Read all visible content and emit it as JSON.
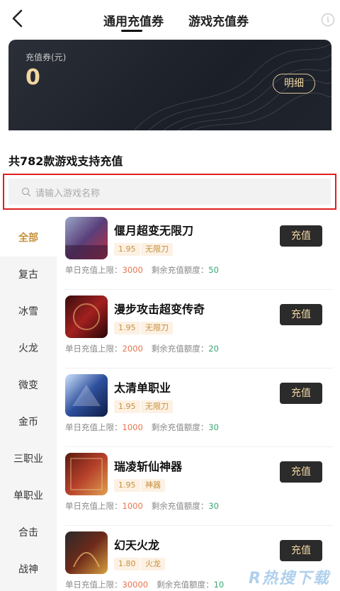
{
  "header": {
    "tabs": [
      {
        "label": "通用充值券",
        "active": true
      },
      {
        "label": "游戏充值券",
        "active": false
      }
    ],
    "info_icon": "info-icon"
  },
  "card": {
    "label": "充值券(元)",
    "amount": "0",
    "detail_button": "明细"
  },
  "games_count_title": "共782款游戏支持充值",
  "search": {
    "placeholder": "请输入游戏名称"
  },
  "categories": [
    "全部",
    "复古",
    "冰雪",
    "火龙",
    "微变",
    "金币",
    "三职业",
    "单职业",
    "合击",
    "战神"
  ],
  "limit_labels": {
    "daily": "单日充值上限：",
    "remaining": "剩余充值额度："
  },
  "recharge_label": "充值",
  "games": [
    {
      "name": "偃月超变无限刀",
      "discount": "1.95",
      "tag": "无限刀",
      "daily_limit": "3000",
      "remaining": "50"
    },
    {
      "name": "漫步攻击超变传奇",
      "discount": "1.95",
      "tag": "无限刀",
      "daily_limit": "2000",
      "remaining": "20"
    },
    {
      "name": "太清单职业",
      "discount": "1.95",
      "tag": "无限刀",
      "daily_limit": "1000",
      "remaining": "30"
    },
    {
      "name": "瑞凌斩仙神器",
      "discount": "1.95",
      "tag": "神器",
      "daily_limit": "1000",
      "remaining": "30"
    },
    {
      "name": "幻天火龙",
      "discount": "1.80",
      "tag": "火龙",
      "daily_limit": "30000",
      "remaining": "10"
    }
  ],
  "watermark": "R热搜下载",
  "colors": {
    "accent": "#c7913c",
    "card_bg": "#1f232b",
    "limit_orange": "#e9734c",
    "limit_green": "#3aa773",
    "search_highlight": "#e01e1e"
  }
}
